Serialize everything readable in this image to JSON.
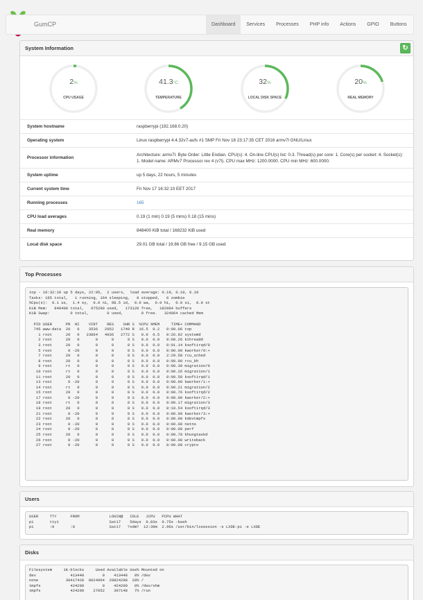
{
  "app": {
    "brand": "GumCP"
  },
  "nav": [
    "Dashboard",
    "Services",
    "Processes",
    "PHP info",
    "Actions",
    "GPIO",
    "Buttons"
  ],
  "system": {
    "title": "System Information",
    "gauges": [
      {
        "value": "2",
        "unit": "%",
        "label": "CPU USAGE",
        "fraction": 0.02
      },
      {
        "value": "41.3",
        "unit": "°C",
        "label": "TEMPERATURE",
        "fraction": 0.413
      },
      {
        "value": "32",
        "unit": "%",
        "label": "LOCAL DISK SPACE",
        "fraction": 0.32
      },
      {
        "value": "20",
        "unit": "%",
        "label": "REAL MEMORY",
        "fraction": 0.2
      }
    ],
    "rows": [
      {
        "key": "System hostname",
        "value": "raspberrypi (192.168.0.20)"
      },
      {
        "key": "Operating system",
        "value": "Linux raspberrypi 4.4.32v7-aufs #1 SMP Fri Nov 18 23:17:35 CET 2016 armv7l GNU/Linux"
      },
      {
        "key": "Processor information",
        "value": "Architecture: armv7l. Byte Order: Little Endian. CPU(s): 4. On-line CPU(s) list: 0-3. Thread(s) per core: 1. Core(s) per socket: 4. Socket(s): 1. Model name: ARMv7 Processor rev 4 (v7l). CPU max MHz: 1200.0000. CPU min MHz: 600.0000."
      },
      {
        "key": "System uptime",
        "value": "up 5 days, 22 hours, 5 minutes"
      },
      {
        "key": "Current system time",
        "value": "Fri Nov 17 16:32:10 EET 2017"
      },
      {
        "key": "Running processes",
        "value": "165"
      },
      {
        "key": "CPU load averages",
        "value": "0.19 (1 min) 0.19 (5 mins) 0.18 (15 mins)"
      },
      {
        "key": "Real memory",
        "value": "848400 KiB total / 168232 KiB used"
      },
      {
        "key": "Local disk space",
        "value": "29.01 GB total / 19.86 GB free / 9.15 GB used"
      }
    ]
  },
  "top": {
    "title": "Top Processes",
    "output": "top - 16:32:10 up 5 days, 22:05,  2 users,  load average: 0.19, 0.19, 0.18\nTasks: 165 total,   1 running, 164 sleeping,   0 stopped,   0 zombie\n%Cpu(s):  0.1 us,  1.4 sy,  0.0 ni, 98.5 id,  0.0 wa,  0.0 hi,  0.0 si,  0.0 st\nKiB Mem:   848400 total,   675280 used,   173120 free,   182984 buffers\nKiB Swap:         0 total,        0 used,        0 free.   324064 cached Mem\n\n  PID USER      PR  NI    VIRT    RES    SHR S  %CPU %MEM     TIME+ COMMAND\n  745 www-data  20   0    3536   2052   1740 R  16.5  0.2   0:00.06 top\n    1 root      20   0   23864   4036   2772 S   0.0  0.5   0:26.92 systemd\n    2 root      20   0       0      0      0 S   0.0  0.0   0:00.26 kthreadd\n    3 root      20   0       0      0      0 S   0.0  0.0   0:01.14 ksoftirqd/0\n    5 root       0 -20       0      0      0 S   0.0  0.0   0:00.00 kworker/0:+\n    7 root      20   0       0      0      0 S   0.0  0.0   2:29.58 rcu_sched\n    8 root      20   0       0      0      0 S   0.0  0.0   0:00.00 rcu_bh\n    9 root      rt   0       0      0      0 S   0.0  0.0   0:00.39 migration/0\n   10 root      rt   0       0      0      0 S   0.0  0.0   0:00.26 migration/1\n   11 root      20   0       0      0      0 S   0.0  0.0   0:00.58 ksoftirqd/1\n   13 root       0 -20       0      0      0 S   0.0  0.0   0:00.00 kworker/1:+\n   14 root      rt   0       0      0      0 S   0.0  0.0   0:00.21 migration/2\n   15 root      20   0       0      0      0 S   0.0  0.0   0:00.76 ksoftirqd/2\n   17 root       0 -20       0      0      0 S   0.0  0.0   0:00.00 kworker/2:+\n   18 root      rt   0       0      0      0 S   0.0  0.0   0:00.17 migration/3\n   19 root      20   0       0      0      0 S   0.0  0.0   0:10.54 ksoftirqd/3\n   21 root       0 -20       0      0      0 S   0.0  0.0   0:00.00 kworker/3:+\n   22 root      20   0       0      0      0 S   0.0  0.0   0:00.00 kdevtmpfs\n   23 root       0 -20       0      0      0 S   0.0  0.0   0:00.00 netns\n   24 root       0 -20       0      0      0 S   0.0  0.0   0:00.00 perf\n   25 root      20   0       0      0      0 S   0.0  0.0   0:00.78 khungtaskd\n   26 root       0 -20       0      0      0 S   0.0  0.0   0:00.00 writeback\n   27 root       0 -20       0      0      0 S   0.0  0.0   0:00.00 crypto"
  },
  "users": {
    "title": "Users",
    "output": "USER     TTY      FROM             LOGIN@   IDLE   JCPU   PCPU WHAT\npi       tty1                      Sat17    5days  0.83s  0.75s -bash\npi       :0       :0               Sat17   ?xdm?  12:30m  2.96s /usr/bin/lxsession -s LXDE-pi -e LXDE"
  },
  "disks": {
    "title": "Disks",
    "output": "Filesystem     1K-blocks     Used Available Use% Mounted on\ndev               413448        0    413448   0% /dev\nnone            30417428  8024964  20824288  28% /\ntmpfs             424200        0    424200   0% /dev/shm\ntmpfs             424200    27052    397148   7% /run"
  },
  "colors": {
    "gauge": "#5cb85c",
    "track": "#eeeeee",
    "link": "#337ab7"
  }
}
